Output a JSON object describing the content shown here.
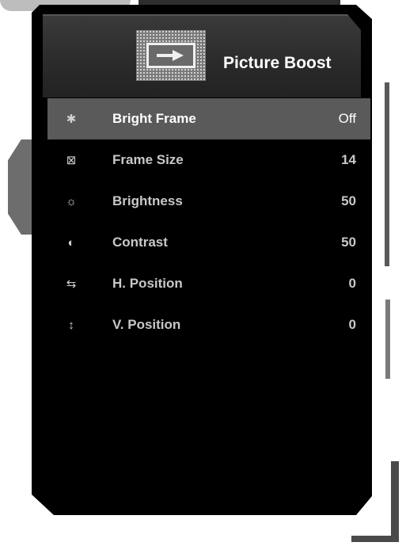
{
  "header": {
    "title": "Picture Boost",
    "icon": "picture-boost-icon"
  },
  "menu": [
    {
      "icon": "bright-frame-icon",
      "glyph": "✱",
      "label": "Bright Frame",
      "value": "Off",
      "selected": true
    },
    {
      "icon": "frame-size-icon",
      "glyph": "⊠",
      "label": "Frame Size",
      "value": "14",
      "selected": false
    },
    {
      "icon": "brightness-icon",
      "glyph": "☼",
      "label": "Brightness",
      "value": "50",
      "selected": false
    },
    {
      "icon": "contrast-icon",
      "glyph": "◐",
      "label": "Contrast",
      "value": "50",
      "selected": false
    },
    {
      "icon": "h-position-icon",
      "glyph": "⇆",
      "label": "H. Position",
      "value": "0",
      "selected": false
    },
    {
      "icon": "v-position-icon",
      "glyph": "↕",
      "label": "V. Position",
      "value": "0",
      "selected": false
    }
  ],
  "colors": {
    "panel": "#000000",
    "header": "#2e2e2e",
    "selected_row": "#5a5a5a",
    "text": "#c8c8c8"
  }
}
